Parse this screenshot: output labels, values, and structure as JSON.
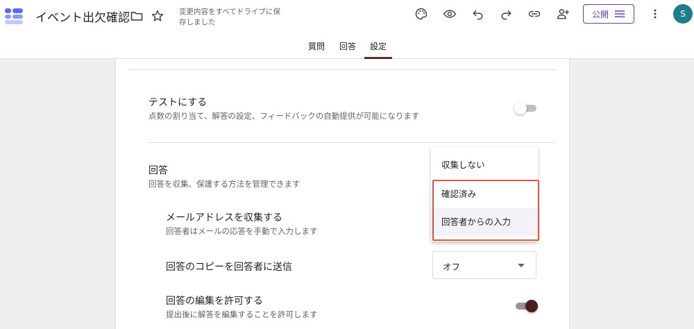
{
  "header": {
    "title": "イベント出欠確認",
    "save_status": "変更内容をすべてドライブに保存しました",
    "publish_label": "公開",
    "avatar_initial": "S",
    "icons": [
      "folder-icon",
      "star-icon",
      "palette-icon",
      "preview-eye-icon",
      "undo-icon",
      "redo-icon",
      "link-icon",
      "add-collaborator-icon",
      "sliders-icon",
      "more-vert-icon"
    ]
  },
  "tabs": [
    {
      "label": "質問"
    },
    {
      "label": "回答"
    },
    {
      "label": "設定",
      "active": true
    }
  ],
  "settings": {
    "quiz": {
      "title": "テストにする",
      "description": "点数の割り当て、解答の設定、フィードバックの自動提供が可能になります",
      "enabled": false
    },
    "responses": {
      "title": "回答",
      "description": "回答を収集、保護する方法を管理できます",
      "collect_email": {
        "title": "メールアドレスを収集する",
        "description": "回答者はメールの応答を手動で入力します"
      },
      "send_copy": {
        "title": "回答のコピーを回答者に送信",
        "value": "オフ"
      },
      "allow_edit": {
        "title": "回答の編集を許可する",
        "description": "提出後に解答を編集することを許可します",
        "enabled": true
      }
    }
  },
  "dropdown": {
    "options": [
      "収集しない",
      "確認済み",
      "回答者からの入力"
    ],
    "hovered_index": 2
  },
  "colors": {
    "accent": "#673ab7",
    "tab_active": "#5b2c2c",
    "highlight": "#e5533a",
    "toggle_on": "#4a1e1e"
  }
}
